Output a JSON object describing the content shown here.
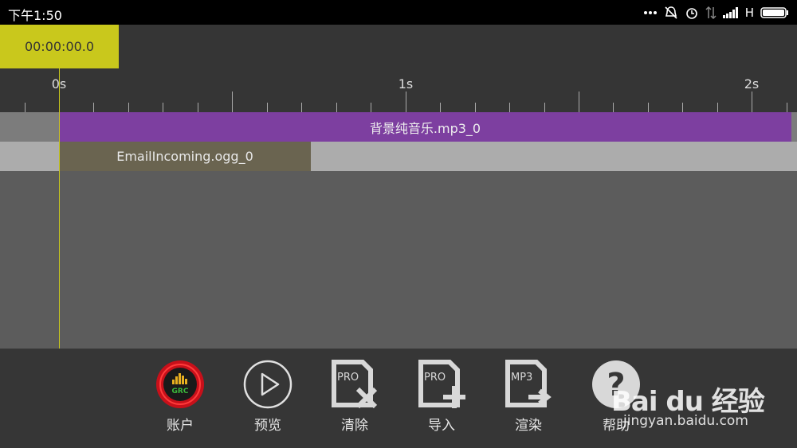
{
  "status_bar": {
    "time": "下午1:50",
    "network": "H"
  },
  "timecode": "00:00:00.0",
  "ruler": {
    "labels": [
      "0s",
      "1s",
      "2s"
    ]
  },
  "tracks": [
    {
      "clip_label": "背景纯音乐.mp3_0",
      "color": "#7d3fa0"
    },
    {
      "clip_label": "EmailIncoming.ogg_0",
      "color": "#6a6450"
    }
  ],
  "toolbar": {
    "account_label": "账户",
    "account_logo_text": "GRC",
    "preview_label": "预览",
    "clear_label": "清除",
    "clear_badge": "PRO",
    "import_label": "导入",
    "import_badge": "PRO",
    "render_label": "渲染",
    "render_badge": "MP3",
    "help_label": "帮助",
    "help_glyph": "?"
  },
  "watermark": {
    "logo": "Bai du 经验",
    "url": "jingyan.baidu.com"
  },
  "colors": {
    "accent": "#c9c81c",
    "background": "#5c5c5c",
    "bar": "#353535"
  }
}
